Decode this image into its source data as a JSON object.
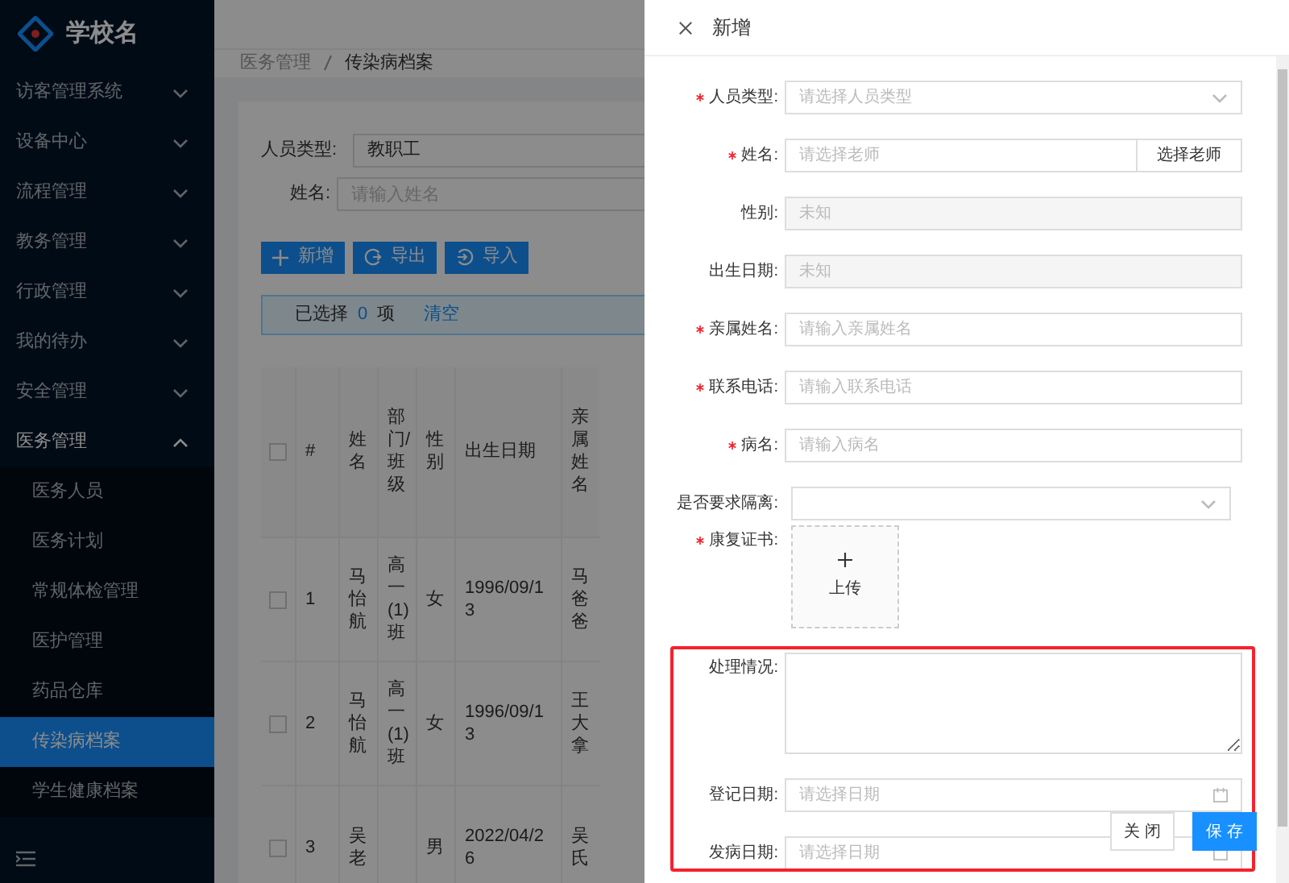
{
  "app": {
    "school_name": "学校名"
  },
  "sidebar": {
    "items": [
      {
        "label": "访客管理系统",
        "expanded": false
      },
      {
        "label": "设备中心",
        "expanded": false
      },
      {
        "label": "流程管理",
        "expanded": false
      },
      {
        "label": "教务管理",
        "expanded": false
      },
      {
        "label": "行政管理",
        "expanded": false
      },
      {
        "label": "我的待办",
        "expanded": false
      },
      {
        "label": "安全管理",
        "expanded": false
      },
      {
        "label": "医务管理",
        "expanded": true,
        "children": [
          {
            "label": "医务人员",
            "selected": false
          },
          {
            "label": "医务计划",
            "selected": false
          },
          {
            "label": "常规体检管理",
            "selected": false
          },
          {
            "label": "医护管理",
            "selected": false
          },
          {
            "label": "药品仓库",
            "selected": false
          },
          {
            "label": "传染病档案",
            "selected": true
          },
          {
            "label": "学生健康档案",
            "selected": false
          }
        ]
      }
    ]
  },
  "breadcrumb": [
    "医务管理",
    "传染病档案"
  ],
  "filters": {
    "person_type": {
      "label": "人员类型:",
      "value": "教职工"
    },
    "name": {
      "label": "姓名:",
      "placeholder": "请输入姓名"
    }
  },
  "toolbar": [
    {
      "kind": "add",
      "label": "新增"
    },
    {
      "kind": "export",
      "label": "导出"
    },
    {
      "kind": "import",
      "label": "导入"
    }
  ],
  "selection": {
    "prefix": "已选择",
    "count": "0",
    "suffix": "项",
    "clear": "清空"
  },
  "table": {
    "all_checked": false,
    "columns": [
      "#",
      "姓名",
      "部门/班级",
      "性别",
      "出生日期",
      "亲属姓名"
    ],
    "rows": [
      {
        "checked": false,
        "cells": [
          "1",
          "马怡航",
          "高一(1)班",
          "女",
          "1996/09/13",
          "马爸爸"
        ]
      },
      {
        "checked": false,
        "cells": [
          "2",
          "马怡航",
          "高一(1)班",
          "女",
          "1996/09/13",
          "王大拿"
        ]
      },
      {
        "checked": false,
        "cells": [
          "3",
          "吴老",
          "",
          "男",
          "2022/04/26",
          "吴氏"
        ]
      }
    ]
  },
  "drawer": {
    "title": "新增",
    "fields": [
      {
        "kind": "select",
        "required": true,
        "label": "人员类型:",
        "placeholder": "请选择人员类型"
      },
      {
        "kind": "input_button",
        "required": true,
        "label": "姓名:",
        "placeholder": "请选择老师",
        "button": "选择老师"
      },
      {
        "kind": "disabled",
        "required": false,
        "label": "性别:",
        "placeholder": "未知"
      },
      {
        "kind": "disabled",
        "required": false,
        "label": "出生日期:",
        "placeholder": "未知"
      },
      {
        "kind": "input",
        "required": true,
        "label": "亲属姓名:",
        "placeholder": "请输入亲属姓名"
      },
      {
        "kind": "input",
        "required": true,
        "label": "联系电话:",
        "placeholder": "请输入联系电话"
      },
      {
        "kind": "input",
        "required": true,
        "label": "病名:",
        "placeholder": "请输入病名"
      },
      {
        "kind": "select_narrow",
        "required": false,
        "label": "是否要求隔离:"
      },
      {
        "kind": "upload",
        "required": true,
        "label": "康复证书:",
        "button": "上传"
      },
      {
        "kind": "textarea",
        "required": false,
        "label": "处理情况:"
      },
      {
        "kind": "date",
        "required": false,
        "label": "登记日期:",
        "placeholder": "请选择日期"
      },
      {
        "kind": "date",
        "required": false,
        "label": "发病日期:",
        "placeholder": "请选择日期"
      }
    ],
    "footer": [
      {
        "kind": "default",
        "label": "关 闭"
      },
      {
        "kind": "primary",
        "label": "保 存"
      }
    ]
  }
}
